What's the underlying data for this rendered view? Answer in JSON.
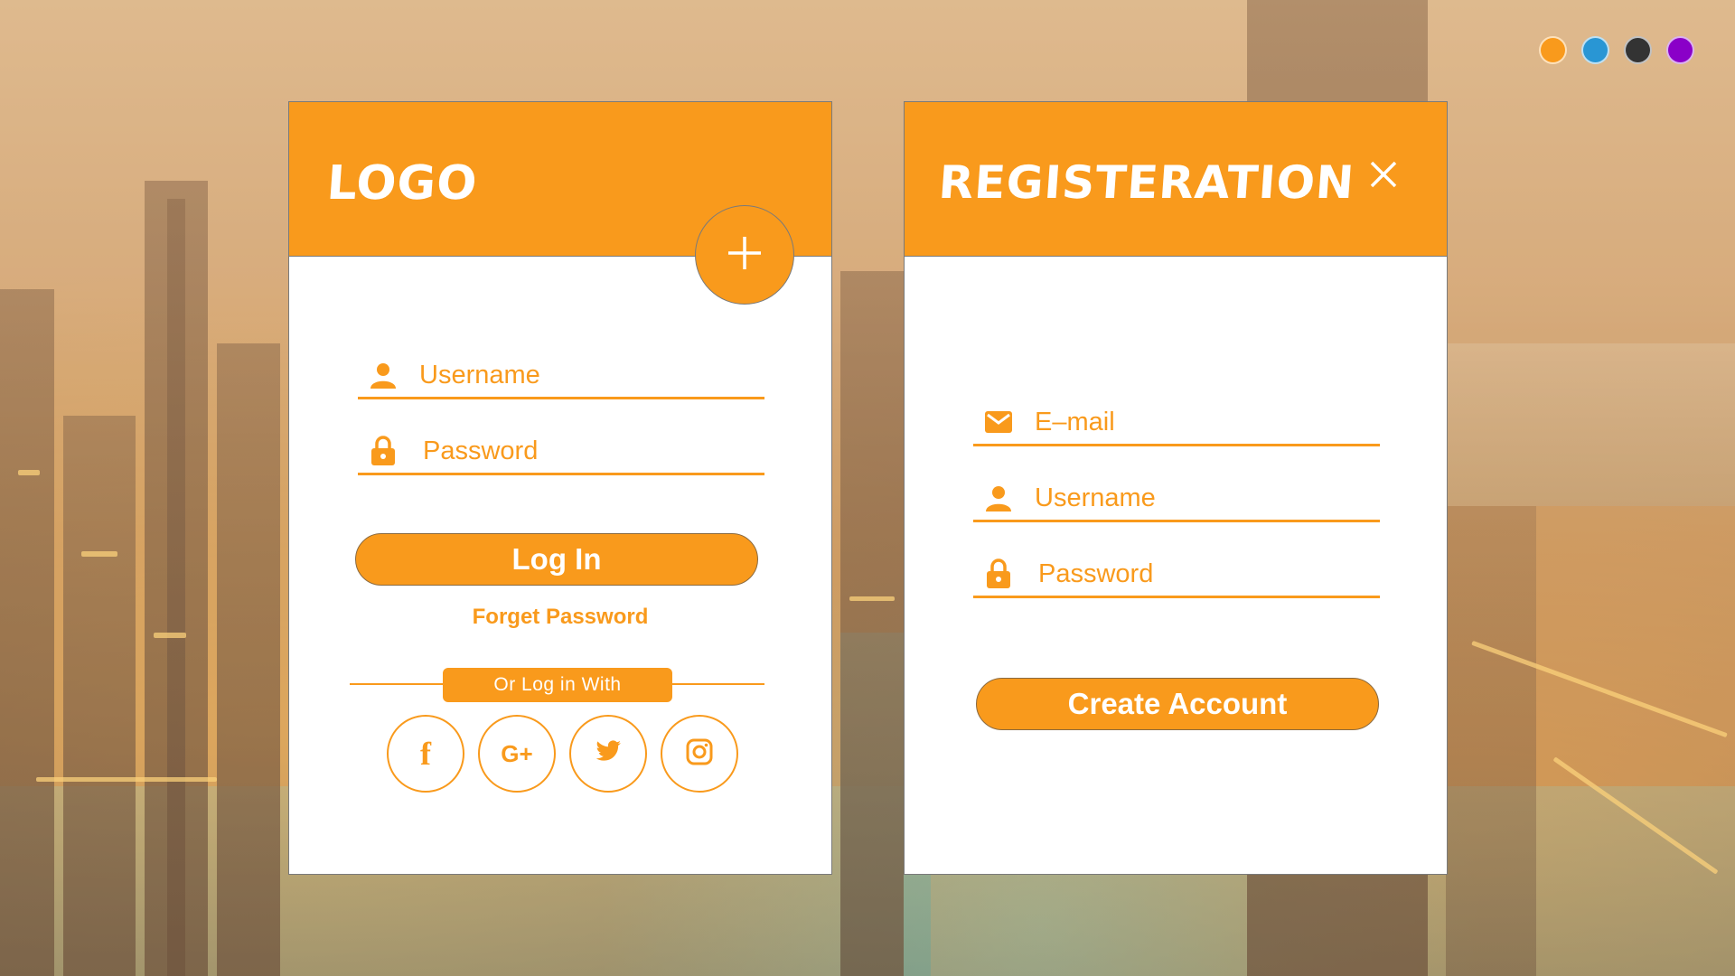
{
  "theme": {
    "accent": "#f99a1c",
    "swatches": [
      {
        "name": "orange",
        "color": "#f99a1c"
      },
      {
        "name": "blue",
        "color": "#2996d4"
      },
      {
        "name": "dark",
        "color": "#333333"
      },
      {
        "name": "purple",
        "color": "#8a00c8"
      }
    ]
  },
  "login": {
    "title": "Logo",
    "username_placeholder": "Username",
    "password_placeholder": "Password",
    "login_button": "Log In",
    "forgot_link": "Forget Password",
    "divider_text": "Or Log in With",
    "social": [
      {
        "icon": "facebook-icon",
        "glyph": "f"
      },
      {
        "icon": "google-plus-icon",
        "glyph": "G+"
      },
      {
        "icon": "twitter-icon",
        "glyph": ""
      },
      {
        "icon": "instagram-icon",
        "glyph": ""
      }
    ]
  },
  "register": {
    "title": "Registeration",
    "email_placeholder": "E–mail",
    "username_placeholder": "Username",
    "password_placeholder": "Password",
    "create_button": "Create Account"
  }
}
